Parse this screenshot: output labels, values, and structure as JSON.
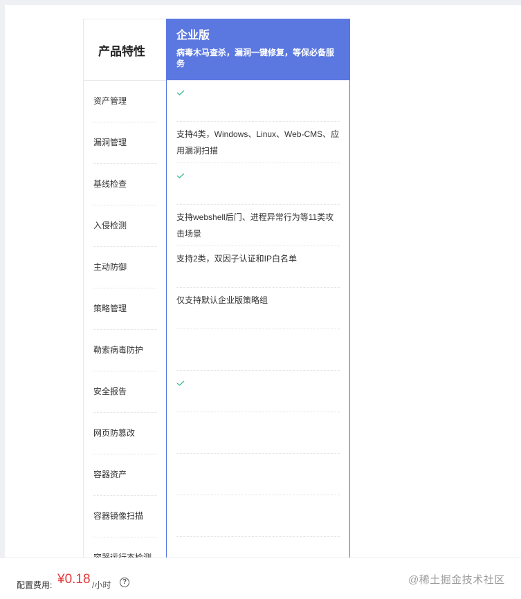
{
  "table": {
    "feature_header": "产品特性",
    "edition": {
      "name": "企业版",
      "description": "病毒木马查杀，漏洞一键修复，等保必备服务"
    },
    "rows": [
      {
        "feature": "资产管理",
        "value": "",
        "check": true
      },
      {
        "feature": "漏洞管理",
        "value": "支持4类，Windows、Linux、Web-CMS、应用漏洞扫描",
        "check": false
      },
      {
        "feature": "基线检查",
        "value": "",
        "check": true
      },
      {
        "feature": "入侵检测",
        "value": "支持webshell后门、进程异常行为等11类攻击场景",
        "check": false
      },
      {
        "feature": "主动防御",
        "value": "支持2类，双因子认证和IP白名单",
        "check": false
      },
      {
        "feature": "策略管理",
        "value": "仅支持默认企业版策略组",
        "check": false
      },
      {
        "feature": "勒索病毒防护",
        "value": "",
        "check": false
      },
      {
        "feature": "安全报告",
        "value": "",
        "check": true
      },
      {
        "feature": "网页防篡改",
        "value": "",
        "check": false
      },
      {
        "feature": "容器资产",
        "value": "",
        "check": false
      },
      {
        "feature": "容器镜像扫描",
        "value": "",
        "check": false
      },
      {
        "feature": "容器运行态检测",
        "value": "",
        "check": false
      }
    ]
  },
  "footer": {
    "fee_label": "配置费用:",
    "price": "¥0.18",
    "unit": "/小时",
    "help_symbol": "?",
    "watermark": "@稀土掘金技术社区"
  },
  "colors": {
    "accent": "#5b78e0",
    "check": "#3fbf8f",
    "price": "#e4393c"
  }
}
